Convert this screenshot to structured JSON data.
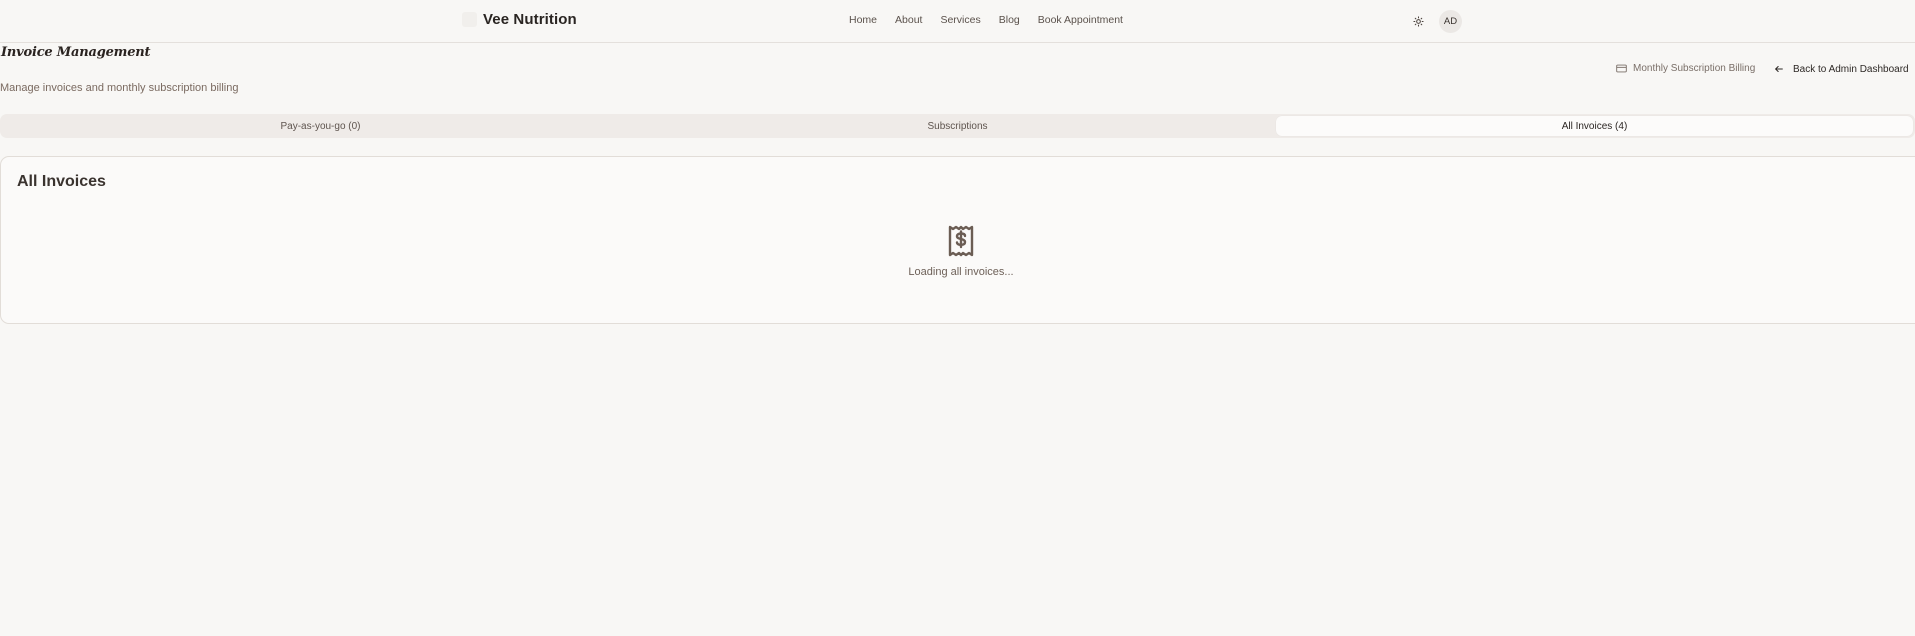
{
  "header": {
    "brand": "Vee Nutrition",
    "nav": [
      "Home",
      "About",
      "Services",
      "Blog",
      "Book Appointment"
    ],
    "theme_icon": "sun-icon",
    "avatar_initials": "AD"
  },
  "page": {
    "title": "Invoice Management",
    "subtitle": "Manage invoices and monthly subscription billing",
    "billing_link_label": "Monthly Subscription Billing",
    "billing_link_icon": "credit-card-icon",
    "back_button_label": "Back to Admin Dashboard",
    "back_button_icon": "arrow-left-icon"
  },
  "tabs": [
    {
      "label": "Pay-as-you-go (0)",
      "active": false
    },
    {
      "label": "Subscriptions",
      "active": false
    },
    {
      "label": "All Invoices (4)",
      "active": true
    }
  ],
  "card": {
    "title": "All Invoices",
    "icon": "receipt-dollar-icon",
    "loading_text": "Loading all invoices..."
  },
  "colors": {
    "background": "#f8f7f5",
    "text": "#2b2623",
    "muted": "#7a6a60",
    "tab_track": "#efebe8"
  }
}
